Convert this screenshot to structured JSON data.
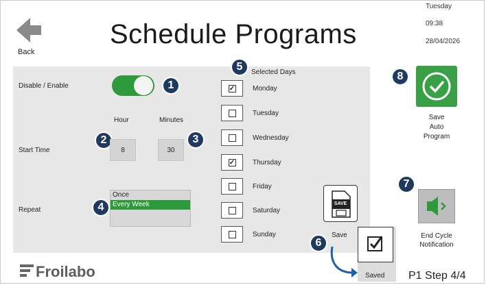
{
  "header": {
    "title": "Schedule Programs",
    "back_label": "Back",
    "day": "Tuesday",
    "time": "09:38",
    "date": "28/04/2026"
  },
  "form": {
    "enable_label": "Disable / Enable",
    "enabled": true,
    "start_time_label": "Start Time",
    "hour_label": "Hour",
    "minutes_label": "Minutes",
    "hour_value": "8",
    "minutes_value": "30",
    "repeat_label": "Repeat",
    "repeat_options": [
      "Once",
      "Every Week"
    ],
    "repeat_selected": "Every Week"
  },
  "days": {
    "header": "Selected Days",
    "items": [
      {
        "label": "Monday",
        "checked": true
      },
      {
        "label": "Tuesday",
        "checked": false
      },
      {
        "label": "Wednesday",
        "checked": false
      },
      {
        "label": "Thursday",
        "checked": true
      },
      {
        "label": "Friday",
        "checked": false
      },
      {
        "label": "Saturday",
        "checked": false
      },
      {
        "label": "Sunday",
        "checked": false
      }
    ]
  },
  "actions": {
    "save_icon_text": "SAVE",
    "save_label": "Save",
    "saved_label": "Saved",
    "save_auto_label_1": "Save",
    "save_auto_label_2": "Auto",
    "save_auto_label_3": "Program",
    "end_cycle_label_1": "End Cycle",
    "end_cycle_label_2": "Notification"
  },
  "badges": [
    "1",
    "2",
    "3",
    "4",
    "5",
    "6",
    "7",
    "8"
  ],
  "footer": {
    "brand": "Froilabo",
    "step": "P1 Step 4/4"
  },
  "colors": {
    "green": "#2f9a3b",
    "badge": "#1f3a5f",
    "panel": "#e7e7e7",
    "arrow": "#1e5fa8"
  },
  "icons": {
    "back": "back-arrow-icon",
    "save_auto": "check-circle-icon",
    "end_cycle": "speaker-icon",
    "save": "save-file-icon"
  }
}
